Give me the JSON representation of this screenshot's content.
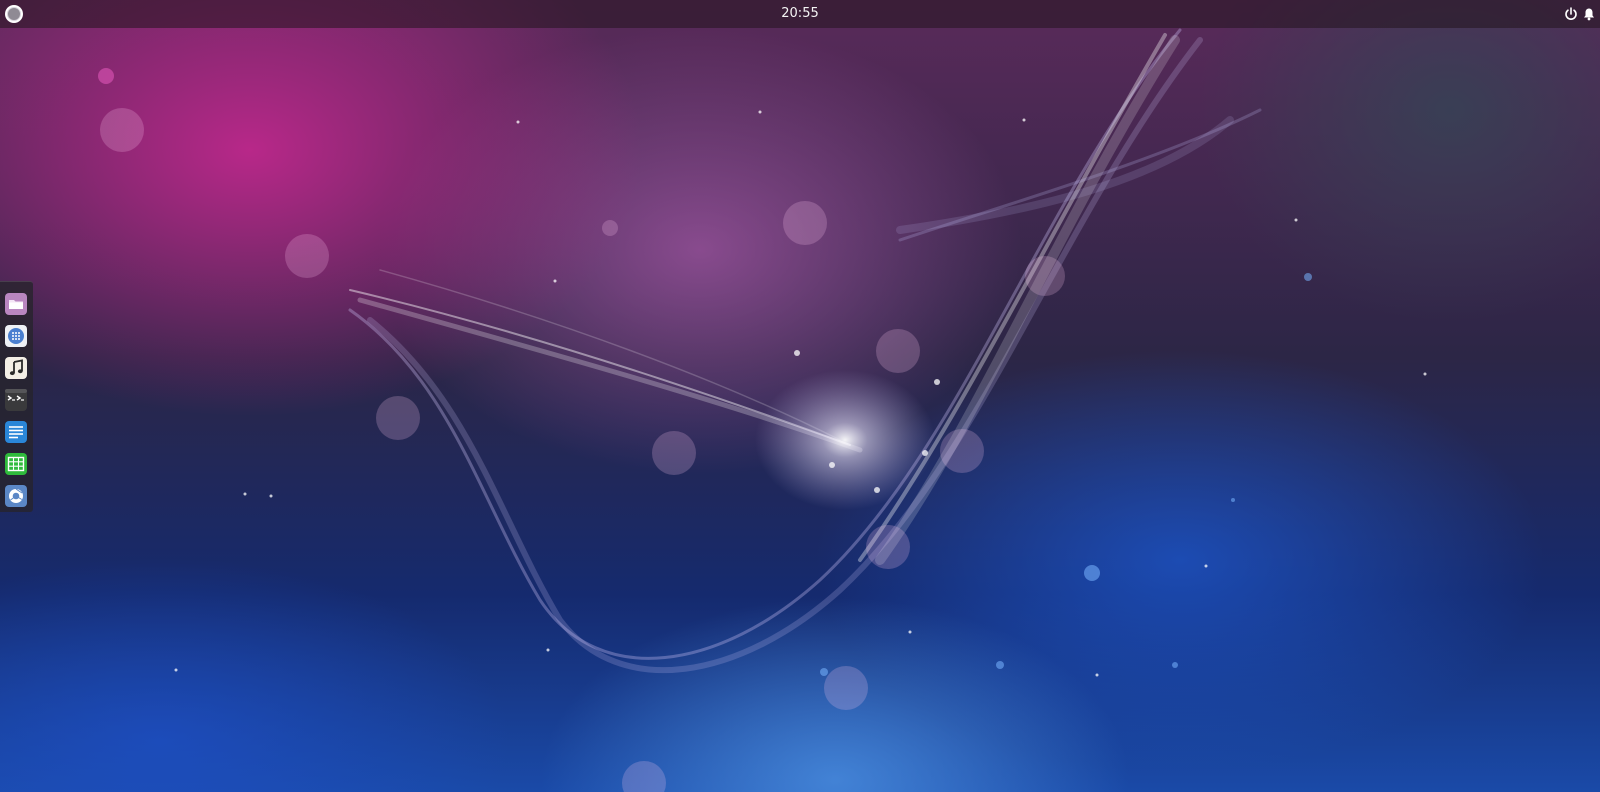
{
  "panel": {
    "clock": "20:55",
    "menu_icon": "circle-menu-icon",
    "tray": [
      {
        "icon": "power-icon"
      },
      {
        "icon": "bell-icon"
      }
    ]
  },
  "dock": {
    "items": [
      {
        "icon": "folder-icon"
      },
      {
        "icon": "app-grid-icon"
      },
      {
        "icon": "music-note-icon"
      },
      {
        "icon": "terminal-icon"
      },
      {
        "icon": "document-icon"
      },
      {
        "icon": "spreadsheet-icon"
      },
      {
        "icon": "browser-icon"
      }
    ]
  },
  "colors": {
    "wallpaper_magenta": "#a0287c",
    "wallpaper_blue": "#1a4aa8",
    "panel": "#23141e",
    "dock": "#26242c"
  }
}
